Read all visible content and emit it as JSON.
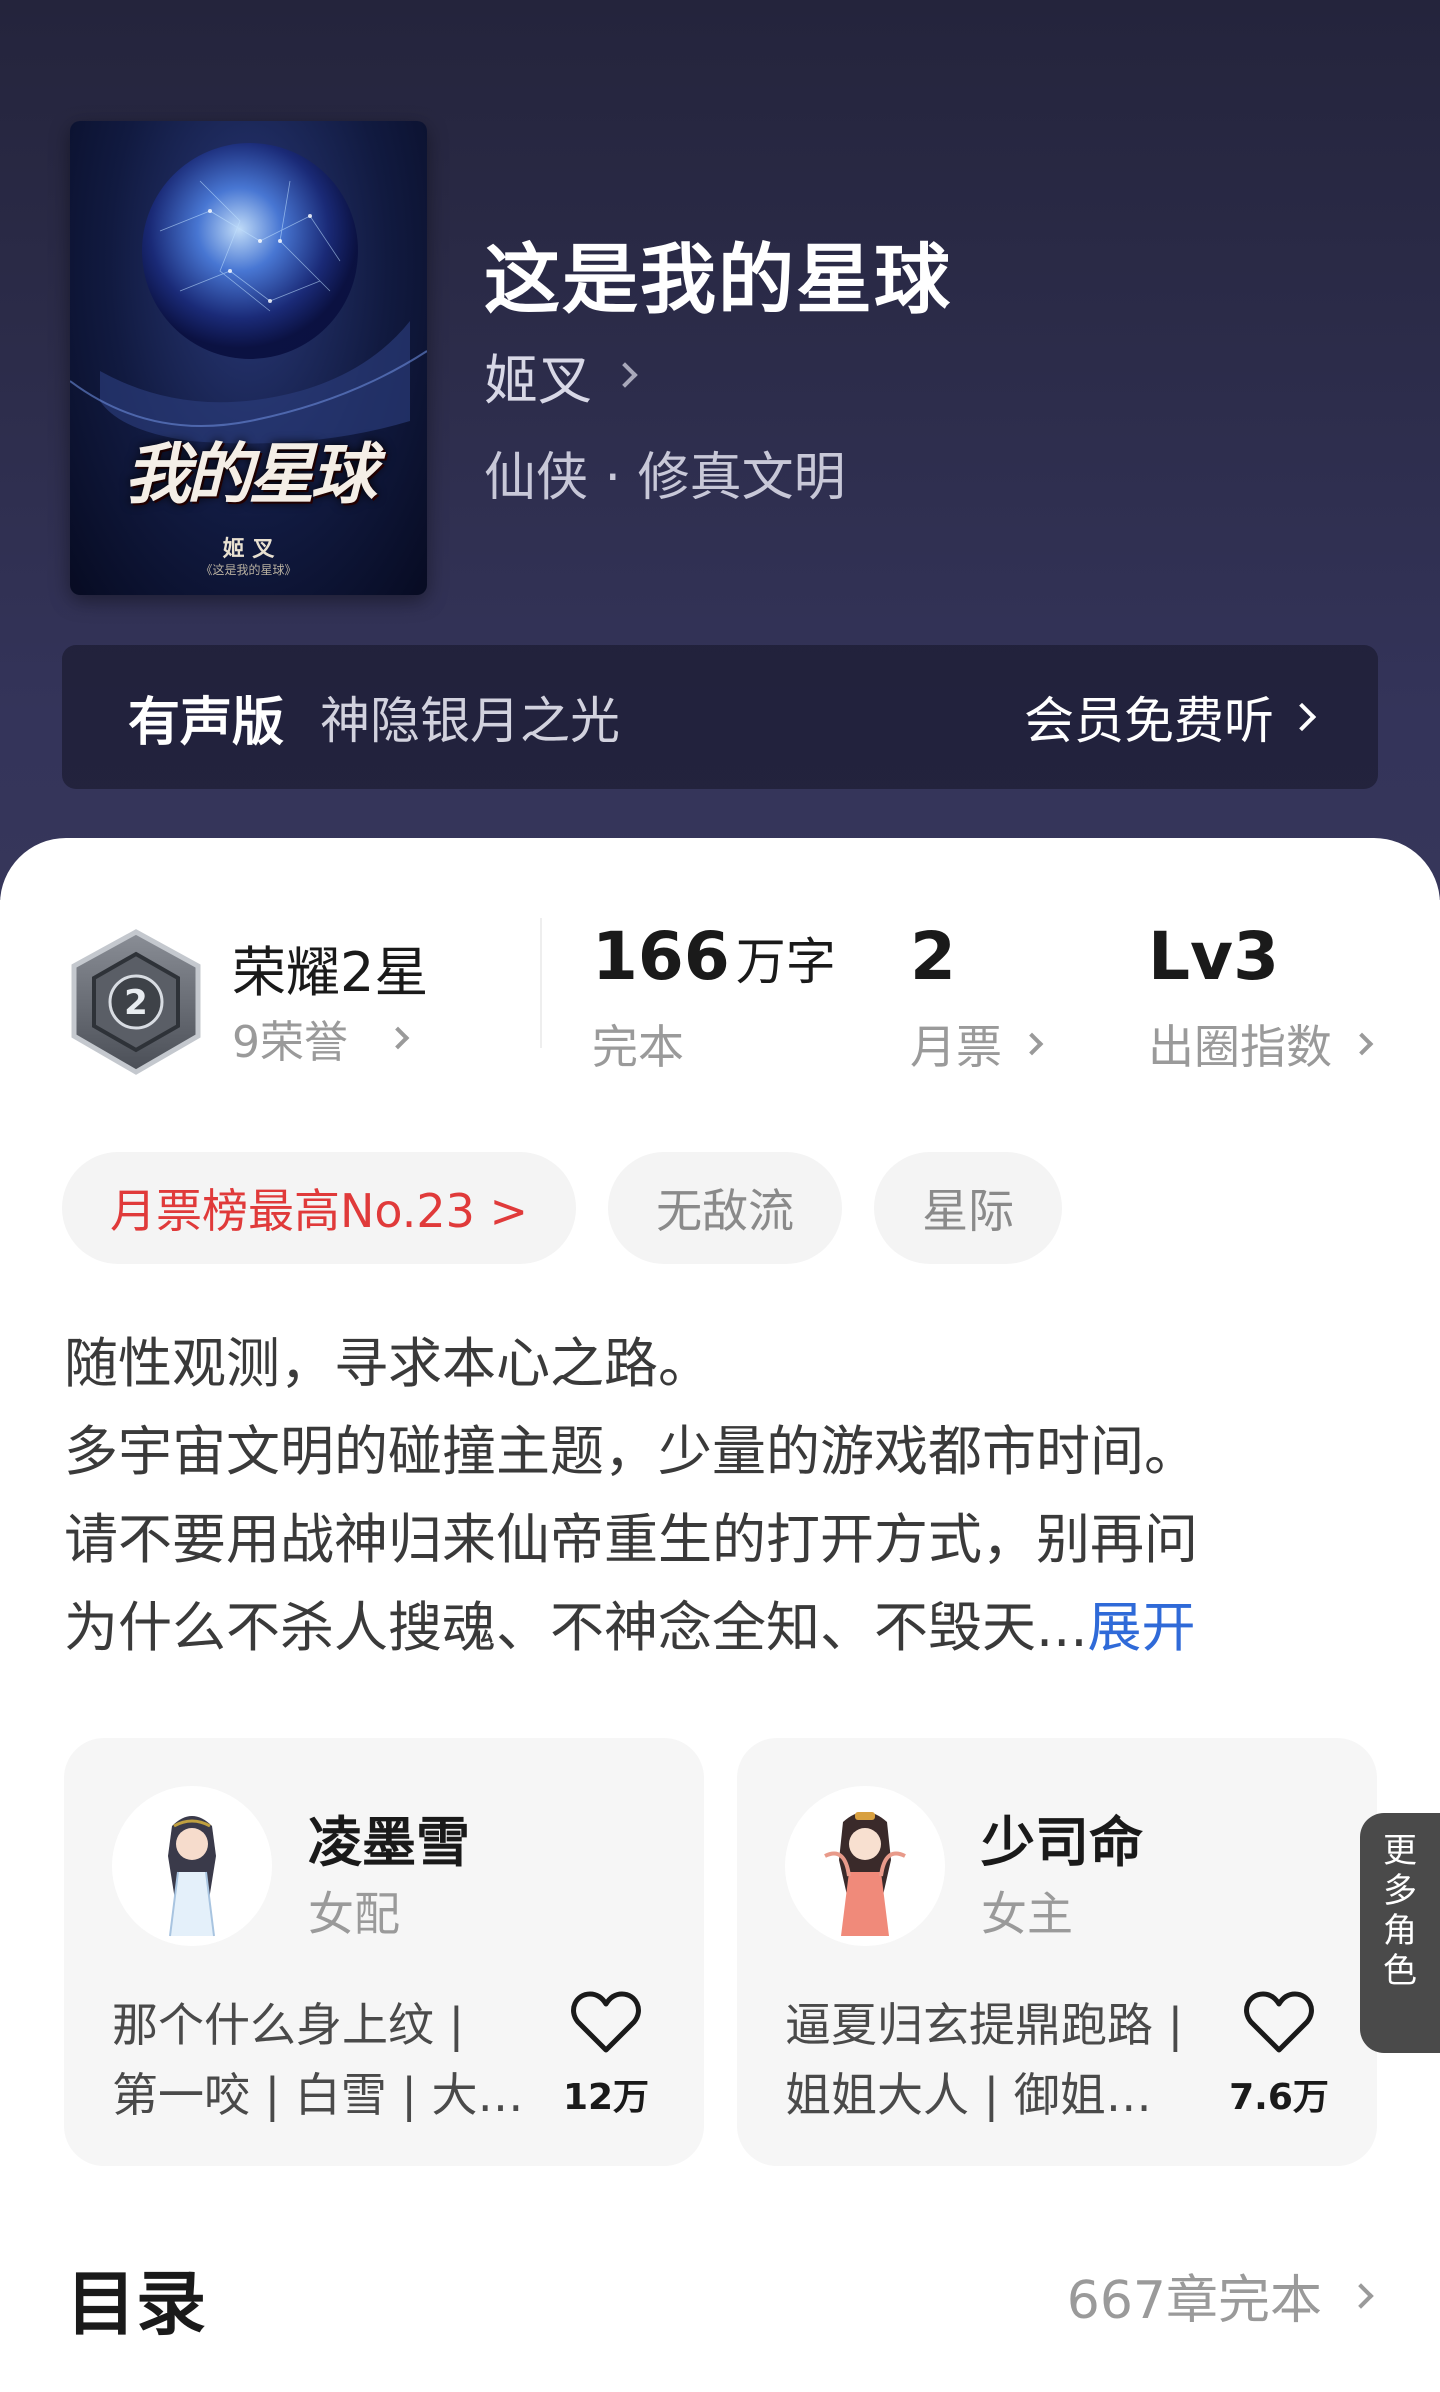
{
  "book": {
    "title": "这是我的星球",
    "author": "姬叉",
    "genre": "仙侠 · 修真文明",
    "cover": {
      "title": "我的星球",
      "prefix": "这是",
      "author": "姬 叉",
      "subtitle": "《这是我的星球》"
    }
  },
  "audio": {
    "label": "有声版",
    "narrator": "神隐银月之光",
    "cta": "会员免费听"
  },
  "stats": {
    "honor_title": "荣耀2星",
    "honor_sub": "9荣誉",
    "badge_level": "2",
    "words_value": "166",
    "words_unit": "万字",
    "words_label": "完本",
    "tickets_value": "2",
    "tickets_label": "月票",
    "index_value": "Lv3",
    "index_label": "出圈指数"
  },
  "tags": [
    "月票榜最高No.23 >",
    "无敌流",
    "星际"
  ],
  "synopsis": {
    "lines": [
      "随性观测，寻求本心之路。",
      "多宇宙文明的碰撞主题，少量的游戏都市时间。",
      "请不要用战神归来仙帝重生的打开方式，别再问",
      "为什么不杀人搜魂、不神念全知、不毁天..."
    ],
    "expand": "展开"
  },
  "characters": [
    {
      "name": "凌墨雪",
      "role": "女配",
      "tags_line1": "那个什么身上纹 |",
      "tags_line2": "第一咬 | 白雪 | 大…",
      "likes": "12万"
    },
    {
      "name": "少司命",
      "role": "女主",
      "tags_line1": "逼夏归玄提鼎跑路 |",
      "tags_line2": "姐姐大人 | 御姐…",
      "likes": "7.6万"
    }
  ],
  "more_roles": [
    "更",
    "多",
    "角",
    "色"
  ],
  "toc": {
    "title": "目录",
    "status": "667章完本"
  },
  "colors": {
    "header_bg": "#2c2c4a",
    "rank_tag": "#e03a3a",
    "expand_link": "#2f6ad8"
  }
}
